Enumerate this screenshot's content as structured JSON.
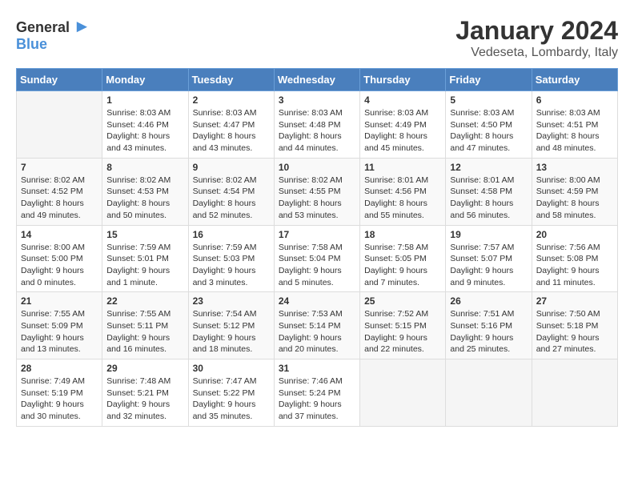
{
  "logo": {
    "general": "General",
    "blue": "Blue"
  },
  "title": "January 2024",
  "subtitle": "Vedeseta, Lombardy, Italy",
  "weekdays": [
    "Sunday",
    "Monday",
    "Tuesday",
    "Wednesday",
    "Thursday",
    "Friday",
    "Saturday"
  ],
  "weeks": [
    [
      {
        "day": "",
        "sunrise": "",
        "sunset": "",
        "daylight": ""
      },
      {
        "day": "1",
        "sunrise": "Sunrise: 8:03 AM",
        "sunset": "Sunset: 4:46 PM",
        "daylight": "Daylight: 8 hours and 43 minutes."
      },
      {
        "day": "2",
        "sunrise": "Sunrise: 8:03 AM",
        "sunset": "Sunset: 4:47 PM",
        "daylight": "Daylight: 8 hours and 43 minutes."
      },
      {
        "day": "3",
        "sunrise": "Sunrise: 8:03 AM",
        "sunset": "Sunset: 4:48 PM",
        "daylight": "Daylight: 8 hours and 44 minutes."
      },
      {
        "day": "4",
        "sunrise": "Sunrise: 8:03 AM",
        "sunset": "Sunset: 4:49 PM",
        "daylight": "Daylight: 8 hours and 45 minutes."
      },
      {
        "day": "5",
        "sunrise": "Sunrise: 8:03 AM",
        "sunset": "Sunset: 4:50 PM",
        "daylight": "Daylight: 8 hours and 47 minutes."
      },
      {
        "day": "6",
        "sunrise": "Sunrise: 8:03 AM",
        "sunset": "Sunset: 4:51 PM",
        "daylight": "Daylight: 8 hours and 48 minutes."
      }
    ],
    [
      {
        "day": "7",
        "sunrise": "Sunrise: 8:02 AM",
        "sunset": "Sunset: 4:52 PM",
        "daylight": "Daylight: 8 hours and 49 minutes."
      },
      {
        "day": "8",
        "sunrise": "Sunrise: 8:02 AM",
        "sunset": "Sunset: 4:53 PM",
        "daylight": "Daylight: 8 hours and 50 minutes."
      },
      {
        "day": "9",
        "sunrise": "Sunrise: 8:02 AM",
        "sunset": "Sunset: 4:54 PM",
        "daylight": "Daylight: 8 hours and 52 minutes."
      },
      {
        "day": "10",
        "sunrise": "Sunrise: 8:02 AM",
        "sunset": "Sunset: 4:55 PM",
        "daylight": "Daylight: 8 hours and 53 minutes."
      },
      {
        "day": "11",
        "sunrise": "Sunrise: 8:01 AM",
        "sunset": "Sunset: 4:56 PM",
        "daylight": "Daylight: 8 hours and 55 minutes."
      },
      {
        "day": "12",
        "sunrise": "Sunrise: 8:01 AM",
        "sunset": "Sunset: 4:58 PM",
        "daylight": "Daylight: 8 hours and 56 minutes."
      },
      {
        "day": "13",
        "sunrise": "Sunrise: 8:00 AM",
        "sunset": "Sunset: 4:59 PM",
        "daylight": "Daylight: 8 hours and 58 minutes."
      }
    ],
    [
      {
        "day": "14",
        "sunrise": "Sunrise: 8:00 AM",
        "sunset": "Sunset: 5:00 PM",
        "daylight": "Daylight: 9 hours and 0 minutes."
      },
      {
        "day": "15",
        "sunrise": "Sunrise: 7:59 AM",
        "sunset": "Sunset: 5:01 PM",
        "daylight": "Daylight: 9 hours and 1 minute."
      },
      {
        "day": "16",
        "sunrise": "Sunrise: 7:59 AM",
        "sunset": "Sunset: 5:03 PM",
        "daylight": "Daylight: 9 hours and 3 minutes."
      },
      {
        "day": "17",
        "sunrise": "Sunrise: 7:58 AM",
        "sunset": "Sunset: 5:04 PM",
        "daylight": "Daylight: 9 hours and 5 minutes."
      },
      {
        "day": "18",
        "sunrise": "Sunrise: 7:58 AM",
        "sunset": "Sunset: 5:05 PM",
        "daylight": "Daylight: 9 hours and 7 minutes."
      },
      {
        "day": "19",
        "sunrise": "Sunrise: 7:57 AM",
        "sunset": "Sunset: 5:07 PM",
        "daylight": "Daylight: 9 hours and 9 minutes."
      },
      {
        "day": "20",
        "sunrise": "Sunrise: 7:56 AM",
        "sunset": "Sunset: 5:08 PM",
        "daylight": "Daylight: 9 hours and 11 minutes."
      }
    ],
    [
      {
        "day": "21",
        "sunrise": "Sunrise: 7:55 AM",
        "sunset": "Sunset: 5:09 PM",
        "daylight": "Daylight: 9 hours and 13 minutes."
      },
      {
        "day": "22",
        "sunrise": "Sunrise: 7:55 AM",
        "sunset": "Sunset: 5:11 PM",
        "daylight": "Daylight: 9 hours and 16 minutes."
      },
      {
        "day": "23",
        "sunrise": "Sunrise: 7:54 AM",
        "sunset": "Sunset: 5:12 PM",
        "daylight": "Daylight: 9 hours and 18 minutes."
      },
      {
        "day": "24",
        "sunrise": "Sunrise: 7:53 AM",
        "sunset": "Sunset: 5:14 PM",
        "daylight": "Daylight: 9 hours and 20 minutes."
      },
      {
        "day": "25",
        "sunrise": "Sunrise: 7:52 AM",
        "sunset": "Sunset: 5:15 PM",
        "daylight": "Daylight: 9 hours and 22 minutes."
      },
      {
        "day": "26",
        "sunrise": "Sunrise: 7:51 AM",
        "sunset": "Sunset: 5:16 PM",
        "daylight": "Daylight: 9 hours and 25 minutes."
      },
      {
        "day": "27",
        "sunrise": "Sunrise: 7:50 AM",
        "sunset": "Sunset: 5:18 PM",
        "daylight": "Daylight: 9 hours and 27 minutes."
      }
    ],
    [
      {
        "day": "28",
        "sunrise": "Sunrise: 7:49 AM",
        "sunset": "Sunset: 5:19 PM",
        "daylight": "Daylight: 9 hours and 30 minutes."
      },
      {
        "day": "29",
        "sunrise": "Sunrise: 7:48 AM",
        "sunset": "Sunset: 5:21 PM",
        "daylight": "Daylight: 9 hours and 32 minutes."
      },
      {
        "day": "30",
        "sunrise": "Sunrise: 7:47 AM",
        "sunset": "Sunset: 5:22 PM",
        "daylight": "Daylight: 9 hours and 35 minutes."
      },
      {
        "day": "31",
        "sunrise": "Sunrise: 7:46 AM",
        "sunset": "Sunset: 5:24 PM",
        "daylight": "Daylight: 9 hours and 37 minutes."
      },
      {
        "day": "",
        "sunrise": "",
        "sunset": "",
        "daylight": ""
      },
      {
        "day": "",
        "sunrise": "",
        "sunset": "",
        "daylight": ""
      },
      {
        "day": "",
        "sunrise": "",
        "sunset": "",
        "daylight": ""
      }
    ]
  ]
}
